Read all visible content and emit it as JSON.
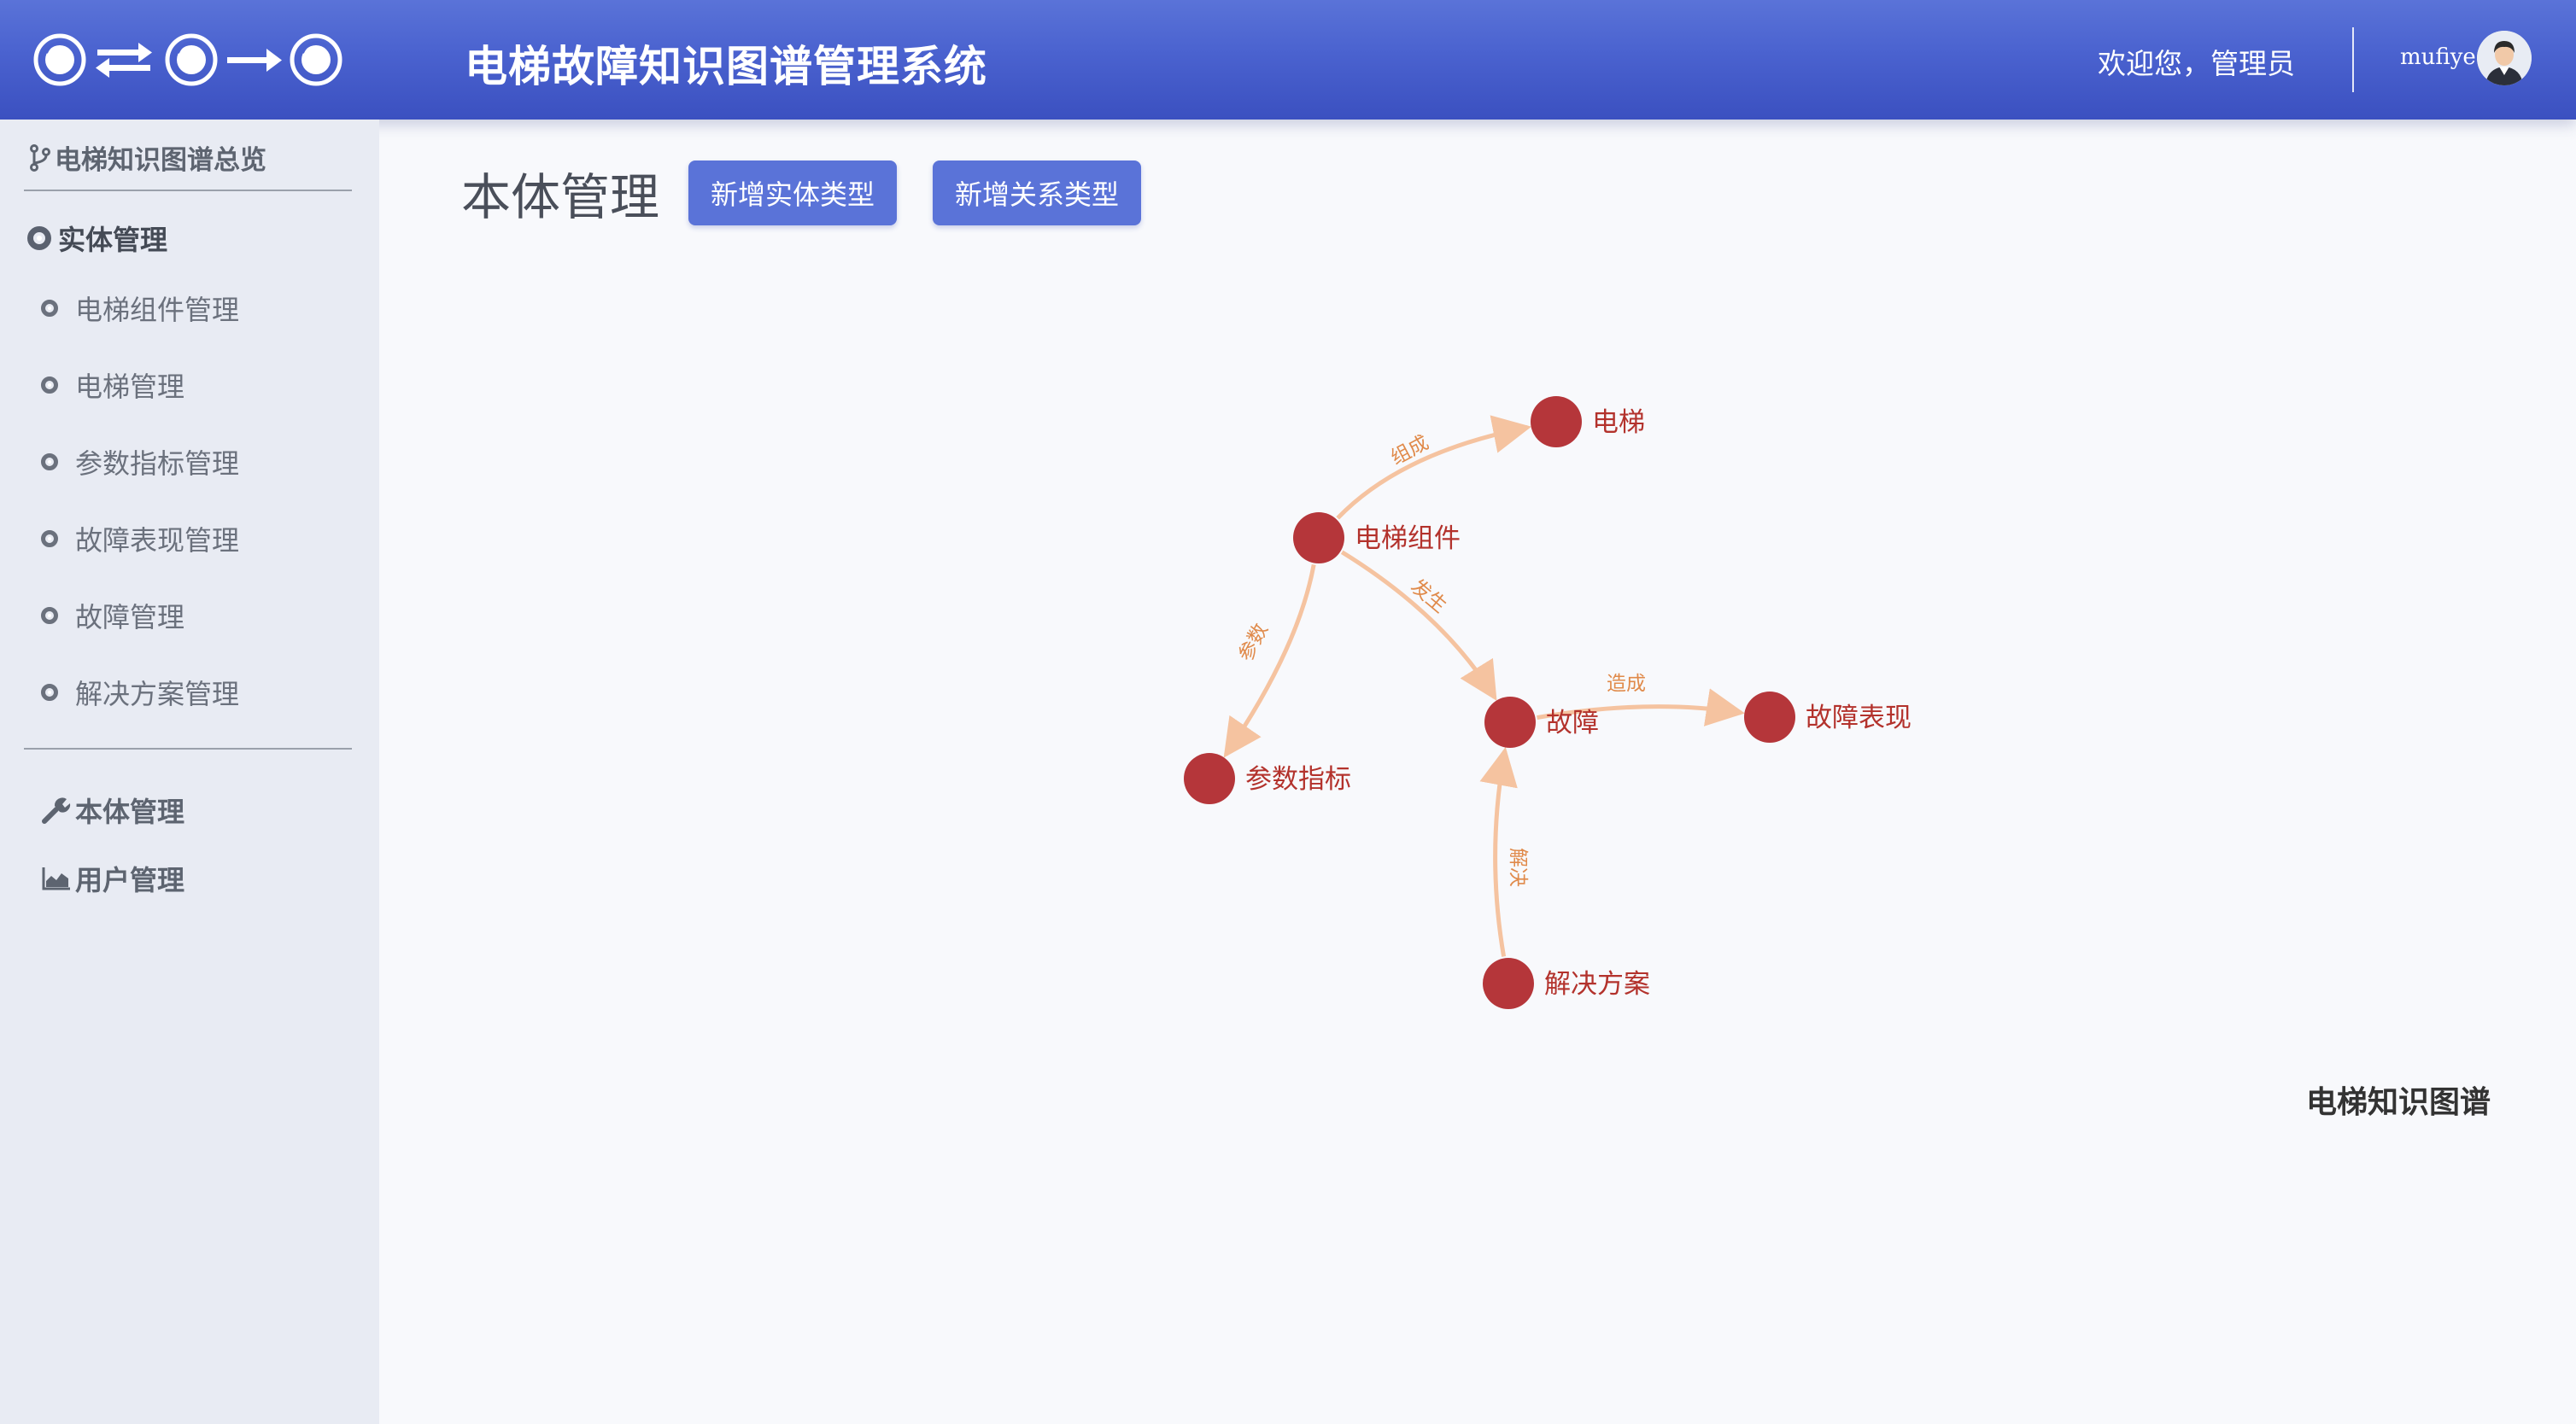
{
  "header": {
    "title": "电梯故障知识图谱管理系统",
    "welcome": "欢迎您，管理员",
    "username": "mufiye",
    "colors": {
      "header_bg": "#4a62cf",
      "accent": "#5a73d8"
    }
  },
  "sidebar": {
    "overview": "电梯知识图谱总览",
    "entity_section": "实体管理",
    "entity_items": [
      {
        "label": "电梯组件管理"
      },
      {
        "label": "电梯管理"
      },
      {
        "label": "参数指标管理"
      },
      {
        "label": "故障表现管理"
      },
      {
        "label": "故障管理"
      },
      {
        "label": "解决方案管理"
      }
    ],
    "ontology": "本体管理",
    "users": "用户管理"
  },
  "main": {
    "title": "本体管理",
    "buttons": {
      "add_entity_type": "新增实体类型",
      "add_relation_type": "新增关系类型"
    },
    "graph_title": "电梯知识图谱"
  },
  "graph": {
    "node_color": "#b5363a",
    "edge_color": "#f5c3a0",
    "nodes": [
      {
        "id": "elevator",
        "label": "电梯"
      },
      {
        "id": "component",
        "label": "电梯组件"
      },
      {
        "id": "param",
        "label": "参数指标"
      },
      {
        "id": "fault",
        "label": "故障"
      },
      {
        "id": "symptom",
        "label": "故障表现"
      },
      {
        "id": "solution",
        "label": "解决方案"
      }
    ],
    "edges": [
      {
        "from": "component",
        "to": "elevator",
        "label": "组成"
      },
      {
        "from": "component",
        "to": "param",
        "label": "参数"
      },
      {
        "from": "component",
        "to": "fault",
        "label": "发生"
      },
      {
        "from": "fault",
        "to": "symptom",
        "label": "造成"
      },
      {
        "from": "solution",
        "to": "fault",
        "label": "解决"
      }
    ]
  }
}
